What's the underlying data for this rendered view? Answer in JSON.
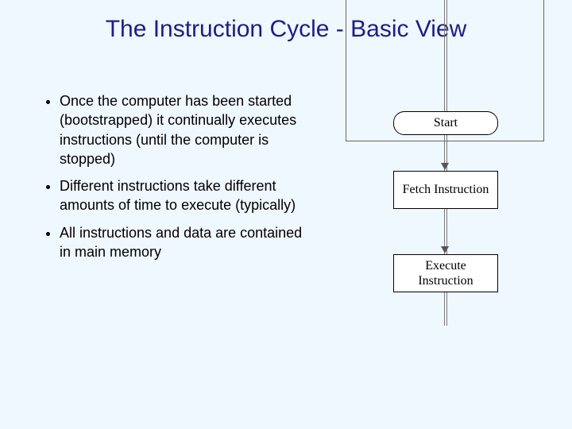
{
  "title": "The Instruction Cycle - Basic View",
  "bullets": [
    "Once the computer has been started (bootstrapped) it continually executes instructions (until the computer is stopped)",
    "Different instructions take different amounts of time to execute (typically)",
    "All instructions and data are contained in main memory"
  ],
  "flow": {
    "start": "Start",
    "fetch": "Fetch Instruction",
    "execute": "Execute Instruction"
  }
}
